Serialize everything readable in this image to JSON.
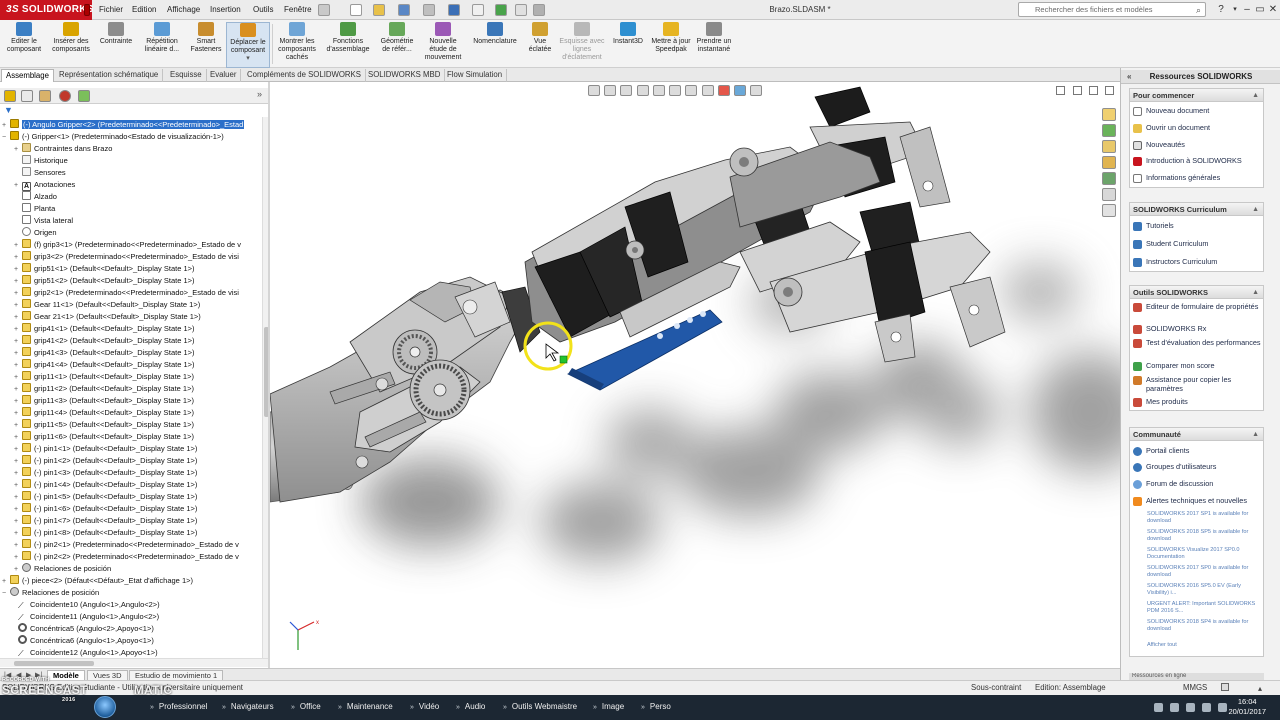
{
  "title_bar": {
    "brand_ds": "3S",
    "brand": "SOLIDWORKS",
    "menus": [
      "Fichier",
      "Edition",
      "Affichage",
      "Insertion",
      "Outils",
      "Fenêtre"
    ],
    "document_title": "Brazo.SLDASM *",
    "search_placeholder": "Rechercher des fichiers et modèles",
    "search_icon": "magnifier-icon",
    "help": "?",
    "minimize": "–",
    "restore": "▭",
    "close": "✕"
  },
  "ribbon": {
    "buttons": [
      {
        "label": "Editer le composant",
        "color": "#3b7fc4"
      },
      {
        "label": "Insérer des composants",
        "color": "#d9a400"
      },
      {
        "label": "Contrainte",
        "color": "#8c8c8c"
      },
      {
        "label": "Répétition linéaire d...",
        "color": "#5b9bd5"
      },
      {
        "label": "Smart Fasteners",
        "color": "#c88d2e"
      },
      {
        "label": "Déplacer le composant",
        "color": "#d98f1f"
      },
      {
        "label": "Montrer les composants cachés",
        "color": "#6fa5d6"
      },
      {
        "label": "Fonctions d'assemblage",
        "color": "#4f9a45"
      },
      {
        "label": "Géométrie de référ...",
        "color": "#67a85a"
      },
      {
        "label": "Nouvelle étude de mouvement",
        "color": "#9b59b6"
      },
      {
        "label": "Nomenclature",
        "color": "#3a76b8"
      },
      {
        "label": "Vue éclatée",
        "color": "#d0a030"
      },
      {
        "label": "Esquisse avec lignes d'éclatement",
        "color": "#b8b8b8"
      },
      {
        "label": "Instant3D",
        "color": "#2e8fd0"
      },
      {
        "label": "Mettre à jour Speedpak",
        "color": "#e6b422"
      },
      {
        "label": "Prendre un instantané",
        "color": "#8a8a8a"
      }
    ]
  },
  "command_tabs": [
    "Assemblage",
    "Représentation schématique",
    "Esquisse",
    "Evaluer",
    "Compléments de SOLIDWORKS",
    "SOLIDWORKS MBD",
    "Flow Simulation"
  ],
  "feature_tree": {
    "rows": [
      {
        "text": "(-) Angulo Gripper<2> (Predeterminado<<Predeterminado>_Estad",
        "icon": "assembly",
        "selected": true
      },
      {
        "text": "(-) Gripper<1> (Predeterminado<Estado de visualización-1>)",
        "icon": "assembly"
      },
      {
        "text": "Contraintes dans Brazo",
        "icon": "folder"
      },
      {
        "text": "Historique",
        "icon": "folder"
      },
      {
        "text": "Sensores",
        "icon": "folder"
      },
      {
        "text": "Anotaciones",
        "icon": "annotation"
      },
      {
        "text": "Alzado",
        "icon": "plane"
      },
      {
        "text": "Planta",
        "icon": "plane"
      },
      {
        "text": "Vista lateral",
        "icon": "plane"
      },
      {
        "text": "Origen",
        "icon": "origin"
      },
      {
        "text": "(f) grip3<1> (Predeterminado<<Predeterminado>_Estado de v",
        "icon": "part"
      },
      {
        "text": "grip3<2> (Predeterminado<<Predeterminado>_Estado de visi",
        "icon": "part"
      },
      {
        "text": "grip51<1> (Default<<Default>_Display State 1>)",
        "icon": "part"
      },
      {
        "text": "grip51<2> (Default<<Default>_Display State 1>)",
        "icon": "part"
      },
      {
        "text": "grip2<1> (Predeterminado<<Predeterminado>_Estado de visi",
        "icon": "part"
      },
      {
        "text": "Gear 11<1> (Default<<Default>_Display State 1>)",
        "icon": "part"
      },
      {
        "text": "Gear 21<1> (Default<<Default>_Display State 1>)",
        "icon": "part"
      },
      {
        "text": "grip41<1> (Default<<Default>_Display State 1>)",
        "icon": "part"
      },
      {
        "text": "grip41<2> (Default<<Default>_Display State 1>)",
        "icon": "part"
      },
      {
        "text": "grip41<3> (Default<<Default>_Display State 1>)",
        "icon": "part"
      },
      {
        "text": "grip41<4> (Default<<Default>_Display State 1>)",
        "icon": "part"
      },
      {
        "text": "grip11<1> (Default<<Default>_Display State 1>)",
        "icon": "part"
      },
      {
        "text": "grip11<2> (Default<<Default>_Display State 1>)",
        "icon": "part"
      },
      {
        "text": "grip11<3> (Default<<Default>_Display State 1>)",
        "icon": "part"
      },
      {
        "text": "grip11<4> (Default<<Default>_Display State 1>)",
        "icon": "part"
      },
      {
        "text": "grip11<5> (Default<<Default>_Display State 1>)",
        "icon": "part"
      },
      {
        "text": "grip11<6> (Default<<Default>_Display State 1>)",
        "icon": "part"
      },
      {
        "text": "(-) pin1<1> (Default<<Default>_Display State 1>)",
        "icon": "part"
      },
      {
        "text": "(-) pin1<2> (Default<<Default>_Display State 1>)",
        "icon": "part"
      },
      {
        "text": "(-) pin1<3> (Default<<Default>_Display State 1>)",
        "icon": "part"
      },
      {
        "text": "(-) pin1<4> (Default<<Default>_Display State 1>)",
        "icon": "part"
      },
      {
        "text": "(-) pin1<5> (Default<<Default>_Display State 1>)",
        "icon": "part"
      },
      {
        "text": "(-) pin1<6> (Default<<Default>_Display State 1>)",
        "icon": "part"
      },
      {
        "text": "(-) pin1<7> (Default<<Default>_Display State 1>)",
        "icon": "part"
      },
      {
        "text": "(-) pin1<8> (Default<<Default>_Display State 1>)",
        "icon": "part"
      },
      {
        "text": "(-) pin2<1> (Predeterminado<<Predeterminado>_Estado de v",
        "icon": "part"
      },
      {
        "text": "(-) pin2<2> (Predeterminado<<Predeterminado>_Estado de v",
        "icon": "part"
      },
      {
        "text": "Relaciones de posición",
        "icon": "mates"
      },
      {
        "text": "(-) piece<2> (Défaut<<Défaut>_Etat d'affichage 1>)",
        "icon": "part"
      },
      {
        "text": "Relaciones de posición",
        "icon": "mates"
      },
      {
        "text": "Coincidente10 (Angulo<1>,Angulo<2>)",
        "icon": "coincident"
      },
      {
        "text": "Coincidente11 (Angulo<1>,Angulo<2>)",
        "icon": "coincident"
      },
      {
        "text": "Concéntrica5 (Angulo<2>,Apoyo<1>)",
        "icon": "concentric"
      },
      {
        "text": "Concéntrica6 (Angulo<1>,Apoyo<1>)",
        "icon": "concentric"
      },
      {
        "text": "Coincidente12 (Angulo<1>,Apoyo<1>)",
        "icon": "coincident"
      }
    ]
  },
  "bottom_tabs": [
    "Modèle",
    "Vues 3D",
    "Estudio de movimiento 1"
  ],
  "status_bar": {
    "left": "SOLIDWORKS Edition étudiante - Utilisation universitaire uniquement",
    "state": "Sous-contraint",
    "mode": "Edition: Assemblage",
    "units": "MMGS"
  },
  "task_pane": {
    "title": "Ressources SOLIDWORKS",
    "sections": [
      {
        "title": "Pour commencer",
        "items": [
          "Nouveau document",
          "Ouvrir un document",
          "Nouveautés",
          "Introduction à SOLIDWORKS",
          "Informations générales"
        ]
      },
      {
        "title": "SOLIDWORKS Curriculum",
        "items": [
          "Tutoriels",
          "Student Curriculum",
          "Instructors Curriculum"
        ]
      },
      {
        "title": "Outils SOLIDWORKS",
        "items": [
          "Editeur de formulaire de propriétés",
          "SOLIDWORKS Rx",
          "Test d'évaluation des performances",
          "Comparer mon score",
          "Assistance pour copier les paramètres",
          "Mes produits"
        ]
      },
      {
        "title": "Communauté",
        "items": [
          "Portail clients",
          "Groupes d'utilisateurs",
          "Forum de discussion",
          "Alertes techniques et nouvelles"
        ]
      }
    ],
    "news": [
      "SOLIDWORKS 2017 SP1 is available for download",
      "SOLIDWORKS 2018 SP5 is available for download",
      "SOLIDWORKS Visualize 2017 SP0.0 Documentation",
      "SOLIDWORKS 2017 SP0 is available for download",
      "SOLIDWORKS 2016 SP5.0 EV (Early Visibility) i...",
      "URGENT ALERT: Important SOLIDWORKS PDM 2016 S...",
      "SOLIDWORKS 2018 SP4 is available for download"
    ],
    "show_all": "Afficher tout",
    "bottom_cutoff": "Ressources en ligne"
  },
  "taskbar": {
    "watermark": "SCREENCAST",
    "watermark_suffix": "MATIC",
    "watermark_sub": "RECORDED WITH",
    "watermark_year": "2016",
    "items": [
      "Professionnel",
      "Navigateurs",
      "Office",
      "Maintenance",
      "Vidéo",
      "Audio",
      "Outils Webmaistre",
      "Image",
      "Perso"
    ],
    "time": "16:04",
    "date": "20/01/2017"
  },
  "colors": {
    "brand_red": "#c8141e",
    "selection_blue": "#2b6fc9",
    "highlight_part_blue": "#2158a8",
    "taskbar_bg": "#1c2733"
  }
}
